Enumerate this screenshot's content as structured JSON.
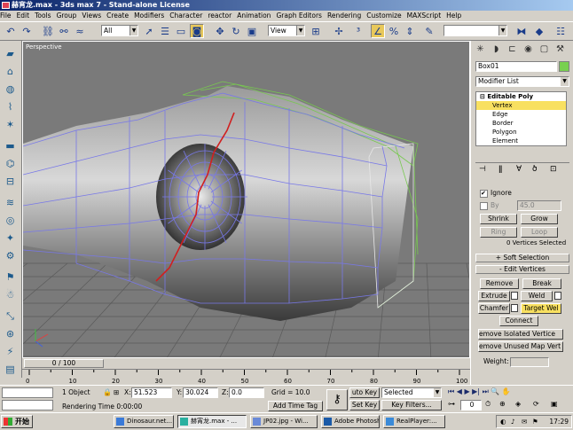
{
  "window": {
    "title": "赫宵龙.max - 3ds max 7 - Stand-alone License"
  },
  "menu": [
    "File",
    "Edit",
    "Tools",
    "Group",
    "Views",
    "Create",
    "Modifiers",
    "Character",
    "reactor",
    "Animation",
    "Graph Editors",
    "Rendering",
    "Customize",
    "MAXScript",
    "Help"
  ],
  "toolbar": {
    "selection_filter": "All",
    "ref_coord": "View"
  },
  "viewport": {
    "label": "Perspective"
  },
  "slider": {
    "label": "0 / 100"
  },
  "trackbar": {
    "ticks": [
      "0",
      "10",
      "20",
      "30",
      "40",
      "50",
      "60",
      "70",
      "80",
      "90",
      "100"
    ]
  },
  "command_panel": {
    "object_name": "Box01",
    "modifier_list": "Modifier List",
    "stack": {
      "root": "Editable Poly",
      "items": [
        "Vertex",
        "Edge",
        "Border",
        "Polygon",
        "Element"
      ],
      "selected": "Vertex"
    },
    "ignore_label": "Ignore",
    "by_label": "By",
    "by_value": "45.0",
    "shrink": "Shrink",
    "grow": "Grow",
    "ring": "Ring",
    "loop": "Loop",
    "vertices_selected": "0 Vertices Selected",
    "soft_selection": "Soft Selection",
    "edit_vertices": "Edit Vertices",
    "remove": "Remove",
    "break": "Break",
    "extrude": "Extrude",
    "weld": "Weld",
    "chamfer": "Chamfer",
    "target_weld": "Target Wel",
    "connect": "Connect",
    "remove_isolated": "emove Isolated Vertice",
    "remove_unused": "emove Unused Map Vert",
    "weight_label": "Weight:"
  },
  "status": {
    "selection": "1 Object",
    "x_label": "X:",
    "x_value": "51.523",
    "y_label": "Y:",
    "y_value": "30.024",
    "z_label": "Z:",
    "z_value": "0.0",
    "grid": "Grid = 10.0",
    "rendering_time": "Rendering Time  0:00:00",
    "add_time_tag": "Add Time Tag",
    "auto_key": "uto Key",
    "auto_key_value": "Selected",
    "set_key": "Set Key",
    "key_filters": "Key Filters...",
    "frame": "0"
  },
  "taskbar": {
    "start": "开始",
    "tasks": [
      "Dinosaur.net...",
      "赫宵龙.max - ...",
      "JP02.jpg - Wi...",
      "Adobe Photoshop",
      "RealPlayer:..."
    ],
    "active_index": 1,
    "clock": "17:29"
  },
  "colors": {
    "viewport_bg": "#7a7a7a",
    "wire_selected": "#7878e8",
    "wire_green": "#78c850",
    "seam": "#d02020",
    "stack_highlight": "#f8e060"
  }
}
